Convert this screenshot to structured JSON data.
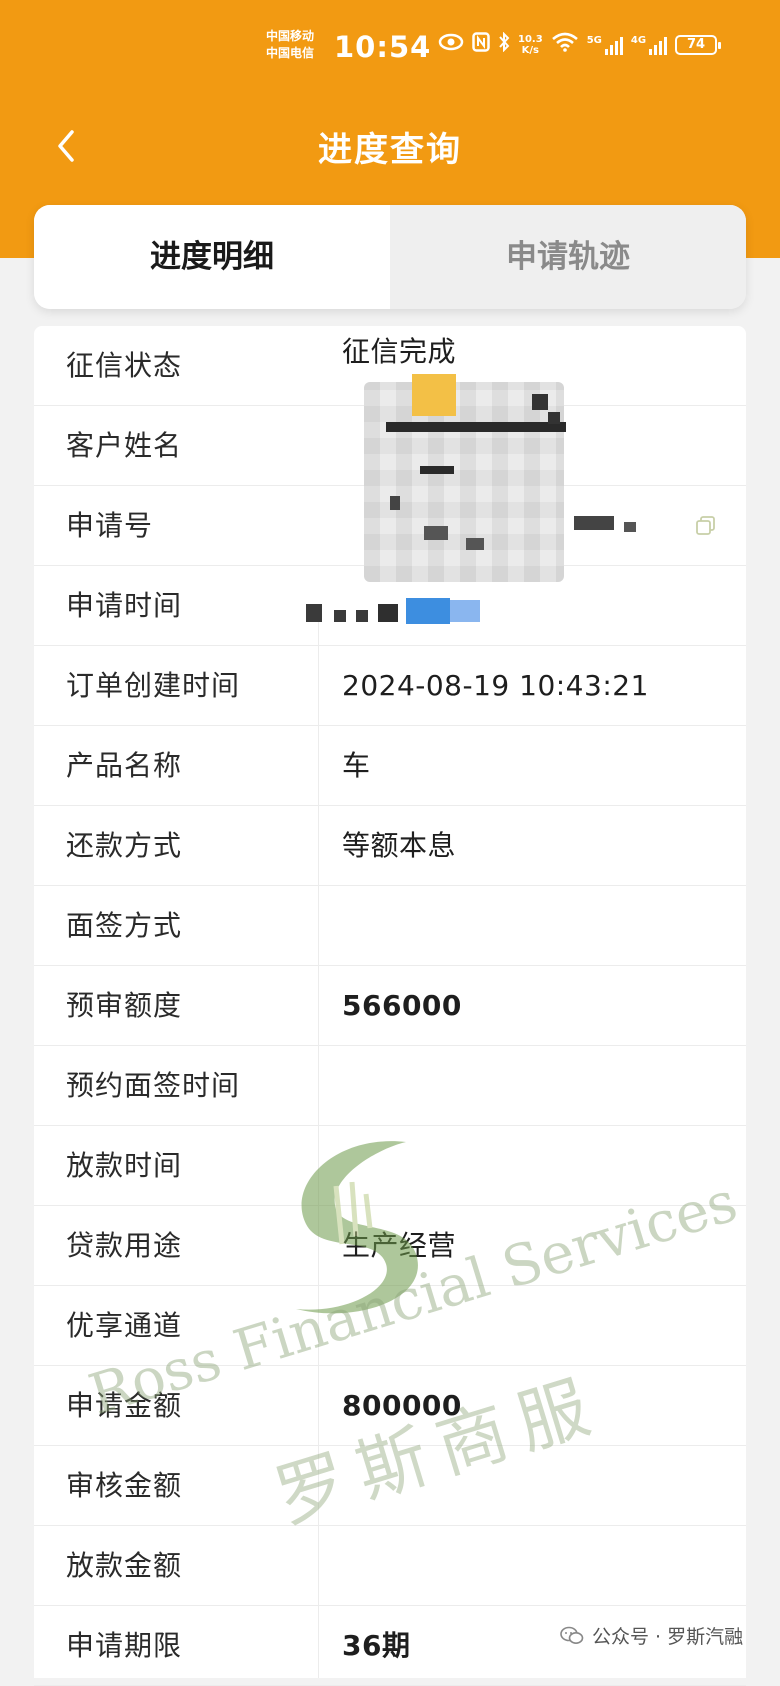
{
  "status_bar": {
    "carrier_1": "中国移动",
    "carrier_2": "中国电信",
    "time": "10:54",
    "net_speed_value": "10.3",
    "net_speed_unit": "K/s",
    "signal_1": "5G",
    "signal_2": "4G",
    "battery": "74"
  },
  "nav": {
    "back_icon": "chevron-left-icon",
    "title": "进度查询"
  },
  "tabs": [
    {
      "label": "进度明细",
      "active": true
    },
    {
      "label": "申请轨迹",
      "active": false
    }
  ],
  "details": {
    "rows": [
      {
        "label": "征信状态",
        "value": "征信完成"
      },
      {
        "label": "客户姓名",
        "value": ""
      },
      {
        "label": "申请号",
        "value": ""
      },
      {
        "label": "申请时间",
        "value": ""
      },
      {
        "label": "订单创建时间",
        "value": "2024-08-19 10:43:21"
      },
      {
        "label": "产品名称",
        "value": "车"
      },
      {
        "label": "还款方式",
        "value": "等额本息"
      },
      {
        "label": "面签方式",
        "value": ""
      },
      {
        "label": "预审额度",
        "value": "566000"
      },
      {
        "label": "预约面签时间",
        "value": ""
      },
      {
        "label": "放款时间",
        "value": ""
      },
      {
        "label": "贷款用途",
        "value": "生产经营"
      },
      {
        "label": "优享通道",
        "value": ""
      },
      {
        "label": "申请金额",
        "value": "800000"
      },
      {
        "label": "审核金额",
        "value": ""
      },
      {
        "label": "放款金额",
        "value": ""
      },
      {
        "label": "申请期限",
        "value": "36期"
      }
    ]
  },
  "watermark": {
    "english": "Ross Financial Services",
    "chinese": "罗斯商服"
  },
  "source": {
    "icon": "wechat-icon",
    "text": "公众号 · 罗斯汽融"
  },
  "colors": {
    "header": "#f29a12",
    "watermark": "#8ca578"
  }
}
